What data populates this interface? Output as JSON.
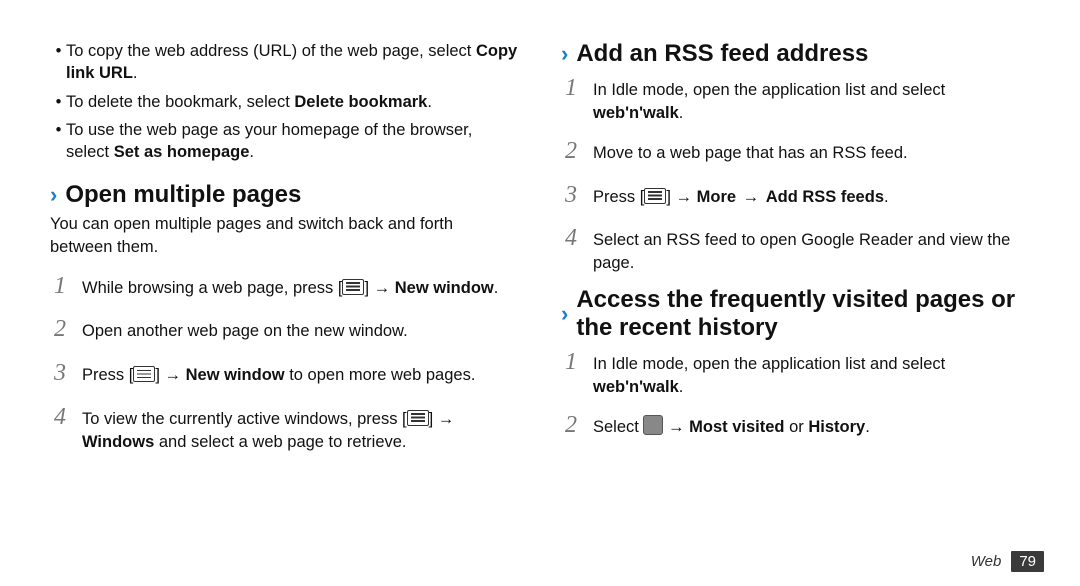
{
  "left": {
    "bullets": [
      {
        "pre": "To copy the web address (URL) of the web page, select ",
        "bold": "Copy link URL",
        "post": "."
      },
      {
        "pre": "To delete the bookmark, select ",
        "bold": "Delete bookmark",
        "post": "."
      },
      {
        "pre": "To use the web page as your homepage of the browser, select ",
        "bold": "Set as homepage",
        "post": "."
      }
    ],
    "sectionA": {
      "title": "Open multiple pages",
      "intro": "You can open multiple pages and switch back and forth between them.",
      "steps": {
        "s1": {
          "num": "1",
          "pre": "While browsing a web page, press [",
          "mid": "] → ",
          "bold": "New window",
          "post": "."
        },
        "s2": {
          "num": "2",
          "text": "Open another web page on the new window."
        },
        "s3": {
          "num": "3",
          "pre": "Press [",
          "mid": "] → ",
          "bold": "New window",
          "post": " to open more web pages."
        },
        "s4": {
          "num": "4",
          "pre": "To view the currently active windows, press [",
          "mid": "] → ",
          "bold": "Windows",
          "post": " and select a web page to retrieve."
        }
      }
    }
  },
  "right": {
    "sectionB": {
      "title": "Add an RSS feed address",
      "steps": {
        "s1": {
          "num": "1",
          "pre": "In Idle mode, open the application list and select ",
          "bold": "web'n'walk",
          "post": "."
        },
        "s2": {
          "num": "2",
          "text": "Move to a web page that has an RSS feed."
        },
        "s3": {
          "num": "3",
          "pre": "Press [",
          "mid": "] → ",
          "bold1": "More",
          "arrow": " → ",
          "bold2": "Add RSS feeds",
          "post": "."
        },
        "s4": {
          "num": "4",
          "text": "Select an RSS feed to open Google Reader and view the page."
        }
      }
    },
    "sectionC": {
      "title": "Access the frequently visited pages or the recent history",
      "steps": {
        "s1": {
          "num": "1",
          "pre": "In Idle mode, open the application list and select ",
          "bold": "web'n'walk",
          "post": "."
        },
        "s2": {
          "num": "2",
          "pre": "Select ",
          "mid": " → ",
          "bold1": "Most visited",
          "or": " or ",
          "bold2": "History",
          "post": "."
        }
      }
    }
  },
  "footer": {
    "section": "Web",
    "page": "79"
  }
}
